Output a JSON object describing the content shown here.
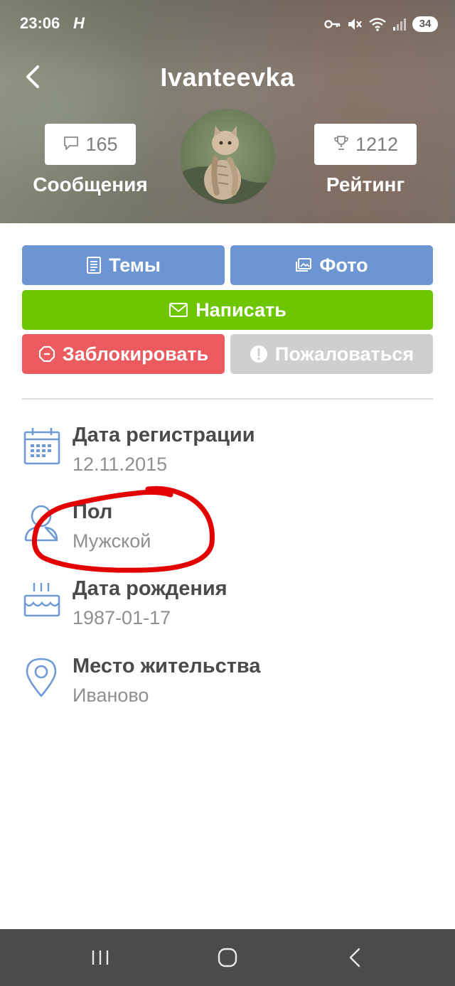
{
  "status_bar": {
    "time": "23:06",
    "notification_glyph": "H",
    "battery": "34",
    "icons": [
      "key-icon",
      "mute-icon",
      "wifi-icon",
      "signal-icon",
      "battery-icon"
    ]
  },
  "header": {
    "title": "Ivanteevka",
    "messages": {
      "count": "165",
      "label": "Сообщения",
      "icon": "comment-icon"
    },
    "rating": {
      "count": "1212",
      "label": "Рейтинг",
      "icon": "trophy-icon"
    },
    "avatar": "cat-avatar"
  },
  "actions": {
    "topics": "Темы",
    "photo": "Фото",
    "write": "Написать",
    "block": "Заблокировать",
    "report": "Пожаловаться"
  },
  "info": [
    {
      "label": "Дата регистрации",
      "value": "12.11.2015",
      "icon": "calendar-icon"
    },
    {
      "label": "Пол",
      "value": "Мужской",
      "icon": "person-icon"
    },
    {
      "label": "Дата рождения",
      "value": "1987-01-17",
      "icon": "cake-icon"
    },
    {
      "label": "Место жительства",
      "value": "Иваново",
      "icon": "location-pin-icon"
    }
  ],
  "colors": {
    "blue": "#6d95d1",
    "green": "#6ec600",
    "red": "#ea5a5f",
    "gray": "#cfcfcf",
    "icon_blue": "#6e9ad6",
    "annotation_red": "#e30000"
  },
  "nav": [
    "recent-apps-button",
    "home-button",
    "back-nav-button"
  ]
}
